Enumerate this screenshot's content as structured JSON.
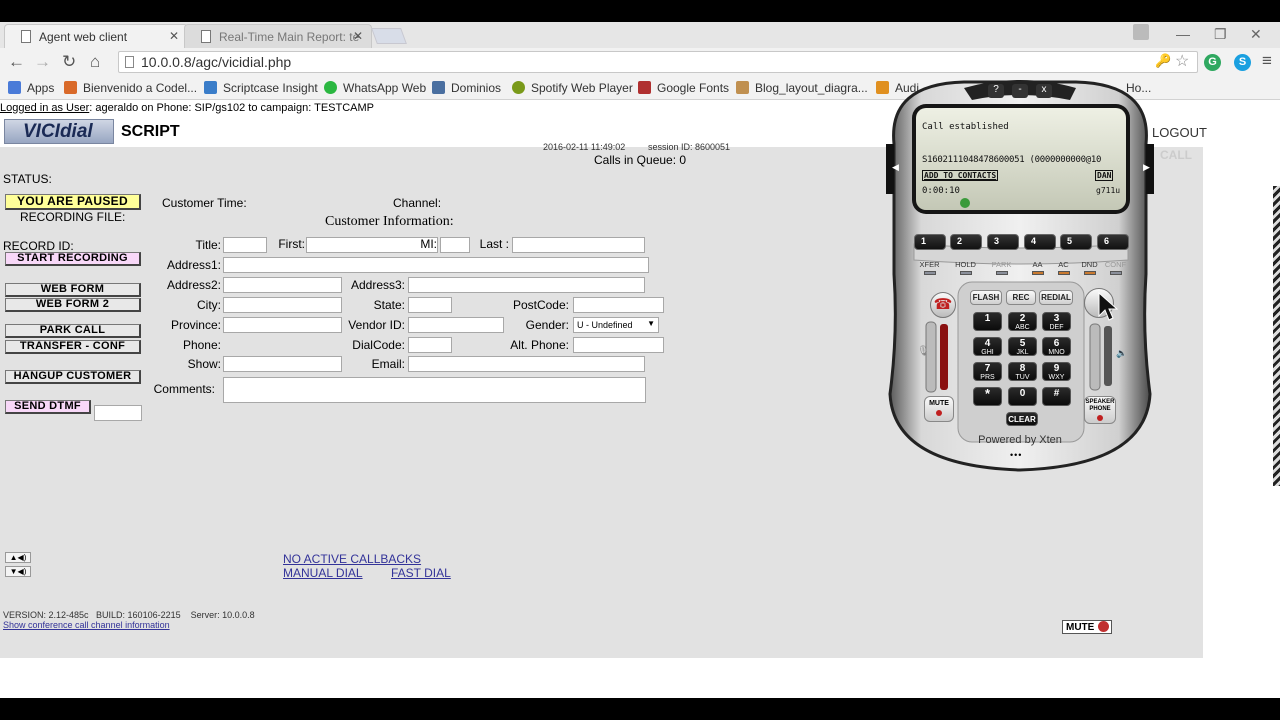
{
  "browser": {
    "tabs": [
      {
        "title": "Agent web client",
        "active": true
      },
      {
        "title": "Real-Time Main Report: te",
        "active": false
      }
    ],
    "url": "10.0.0.8/agc/vicidial.php",
    "bookmarks": [
      {
        "label": "Apps",
        "color": "#4a7bd8"
      },
      {
        "label": "Bienvenido a Codel...",
        "color": "#d96a2a"
      },
      {
        "label": "Scriptcase Insight",
        "color": "#3a7dc9"
      },
      {
        "label": "WhatsApp Web",
        "color": "#2bb741"
      },
      {
        "label": "Dominios",
        "color": "#4a6fa0"
      },
      {
        "label": "Spotify Web Player",
        "color": "#7a9a1a"
      },
      {
        "label": "Google Fonts",
        "color": "#b03030"
      },
      {
        "label": "Blog_layout_diagra...",
        "color": "#c09050"
      },
      {
        "label": "Audi",
        "color": "#e09020"
      },
      {
        "label": "Ho...",
        "color": "#999999"
      }
    ]
  },
  "header": {
    "login_label": "Logged in as User",
    "login_text": ": ageraldo on Phone: SIP/gs102  to campaign: TESTCAMP",
    "logo": "VICIdial",
    "script_tab": "SCRIPT",
    "timestamp": "2016-02-11 11:49:02",
    "session": "session ID: 8600051",
    "calls_in_queue": "Calls in Queue: 0",
    "logout": "LOGOUT",
    "call_label": "CALL"
  },
  "left_panel": {
    "status_label": "STATUS:",
    "paused": "YOU ARE PAUSED",
    "recording_file": "RECORDING FILE:",
    "record_id": "RECORD ID:",
    "start_recording": "START RECORDING",
    "web_form": "WEB FORM",
    "web_form_2": "WEB FORM 2",
    "park_call": "PARK CALL",
    "transfer_conf": "TRANSFER - CONF",
    "hangup_customer": "HANGUP CUSTOMER",
    "send_dtmf": "SEND DTMF"
  },
  "customer": {
    "customer_time": "Customer Time:",
    "channel": "Channel:",
    "section_title": "Customer Information:",
    "title": "Title:",
    "first": "First:",
    "mi": "MI:",
    "last": "Last :",
    "address1": "Address1:",
    "address2": "Address2:",
    "address3": "Address3:",
    "city": "City:",
    "state": "State:",
    "postcode": "PostCode:",
    "province": "Province:",
    "vendor_id": "Vendor ID:",
    "gender": "Gender:",
    "gender_value": "U - Undefined",
    "phone": "Phone:",
    "dialcode": "DialCode:",
    "alt_phone": "Alt. Phone:",
    "show": "Show:",
    "email": "Email:",
    "comments": "Comments:"
  },
  "links": {
    "no_callbacks": "NO ACTIVE CALLBACKS",
    "manual_dial": "MANUAL DIAL",
    "fast_dial": "FAST DIAL",
    "show_conf": "Show conference call channel information"
  },
  "footer": {
    "version": "VERSION: 2.12-485c   BUILD: 160106-2215    Server: 10.0.0.8",
    "mute": "MUTE"
  },
  "softphone": {
    "status": "Call established",
    "sip_uri": "S1602111048478600051 (0000000000@10",
    "add_contacts": "ADD TO CONTACTS",
    "dan": "DAN",
    "timer": "0:00:10",
    "codec": "g711u",
    "lines": [
      "1",
      "2",
      "3",
      "4",
      "5",
      "6"
    ],
    "feature_keys": [
      "XFER",
      "HOLD",
      "PARK",
      "AA",
      "AC",
      "DND",
      "CONF"
    ],
    "soft_keys": [
      "FLASH",
      "REC",
      "REDIAL"
    ],
    "keypad": [
      {
        "d": "1",
        "s": ""
      },
      {
        "d": "2",
        "s": "ABC"
      },
      {
        "d": "3",
        "s": "DEF"
      },
      {
        "d": "4",
        "s": "GHI"
      },
      {
        "d": "5",
        "s": "JKL"
      },
      {
        "d": "6",
        "s": "MNO"
      },
      {
        "d": "7",
        "s": "PRS"
      },
      {
        "d": "8",
        "s": "TUV"
      },
      {
        "d": "9",
        "s": "WXY"
      },
      {
        "d": "*",
        "s": ""
      },
      {
        "d": "0",
        "s": ""
      },
      {
        "d": "#",
        "s": ""
      }
    ],
    "clear": "CLEAR",
    "mute": "MUTE",
    "speaker": "SPEAKER PHONE",
    "powered_by": "Powered by Xten",
    "top_buttons": [
      "?",
      "-",
      "x"
    ]
  },
  "colors": {
    "paused_bg": "#ffff99",
    "record_btn_bg": "#f8d8f8",
    "page_bg": "#e2e2e2",
    "link": "#333399"
  }
}
